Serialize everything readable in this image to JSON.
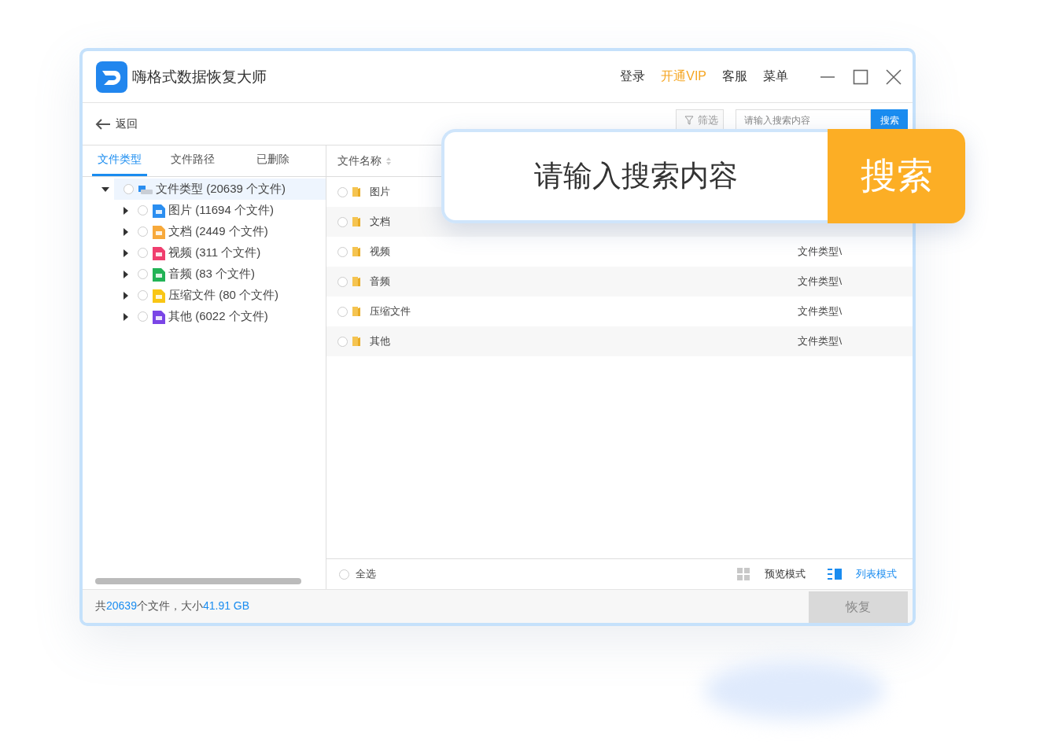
{
  "window": {
    "title": "嗨格式数据恢复大师",
    "menu": [
      {
        "label": "登录",
        "kind": "normal"
      },
      {
        "label": "开通VIP",
        "kind": "vip"
      },
      {
        "label": "客服",
        "kind": "normal"
      },
      {
        "label": "菜单",
        "kind": "normal"
      }
    ]
  },
  "toolbar": {
    "back": "返回",
    "filter": "筛选",
    "search_placeholder": "请输入搜索内容",
    "search_button": "搜索"
  },
  "tabs": [
    {
      "label": "文件类型",
      "selected": true
    },
    {
      "label": "文件路径",
      "selected": false
    },
    {
      "label": "已删除",
      "selected": false
    }
  ],
  "tree": {
    "label": "文件类型 (20639 个文件)",
    "expanded": true,
    "checked": false,
    "children": [
      {
        "label": "图片 (11694 个文件)",
        "color": "#2b8ef0",
        "expanded": false,
        "checked": false
      },
      {
        "label": "文档 (2449 个文件)",
        "color": "#f7a93b",
        "expanded": false,
        "checked": false
      },
      {
        "label": "视频 (311 个文件)",
        "color": "#f03e6e",
        "expanded": false,
        "checked": false
      },
      {
        "label": "音频 (83 个文件)",
        "color": "#22b356",
        "expanded": false,
        "checked": false
      },
      {
        "label": "压缩文件 (80 个文件)",
        "color": "#f9c614",
        "expanded": false,
        "checked": false
      },
      {
        "label": "其他 (6022 个文件)",
        "color": "#7a45e6",
        "expanded": false,
        "checked": false
      }
    ]
  },
  "table": {
    "column": "文件名称",
    "rows": [
      {
        "name": "图片",
        "checked": false
      },
      {
        "name": "文档",
        "checked": false
      },
      {
        "name": "视频",
        "path": "文件类型\\",
        "checked": false
      },
      {
        "name": "音频",
        "path": "文件类型\\",
        "checked": false
      },
      {
        "name": "压缩文件",
        "path": "文件类型\\",
        "checked": false
      },
      {
        "name": "其他",
        "path": "文件类型\\",
        "checked": false
      }
    ]
  },
  "bottom_bar": {
    "select_all": "全选",
    "select_all_checked": false,
    "views": [
      {
        "label": "预览模式",
        "kind": "grid",
        "selected": false
      },
      {
        "label": "列表模式",
        "kind": "list",
        "selected": true
      }
    ]
  },
  "status": {
    "prefix": "共",
    "count": "20639",
    "middle": "个文件，大小",
    "size": "41.91 GB"
  },
  "restore_button": {
    "label": "恢复",
    "disabled": true
  },
  "callout": {
    "placeholder": "请输入搜索内容",
    "button": "搜索"
  }
}
